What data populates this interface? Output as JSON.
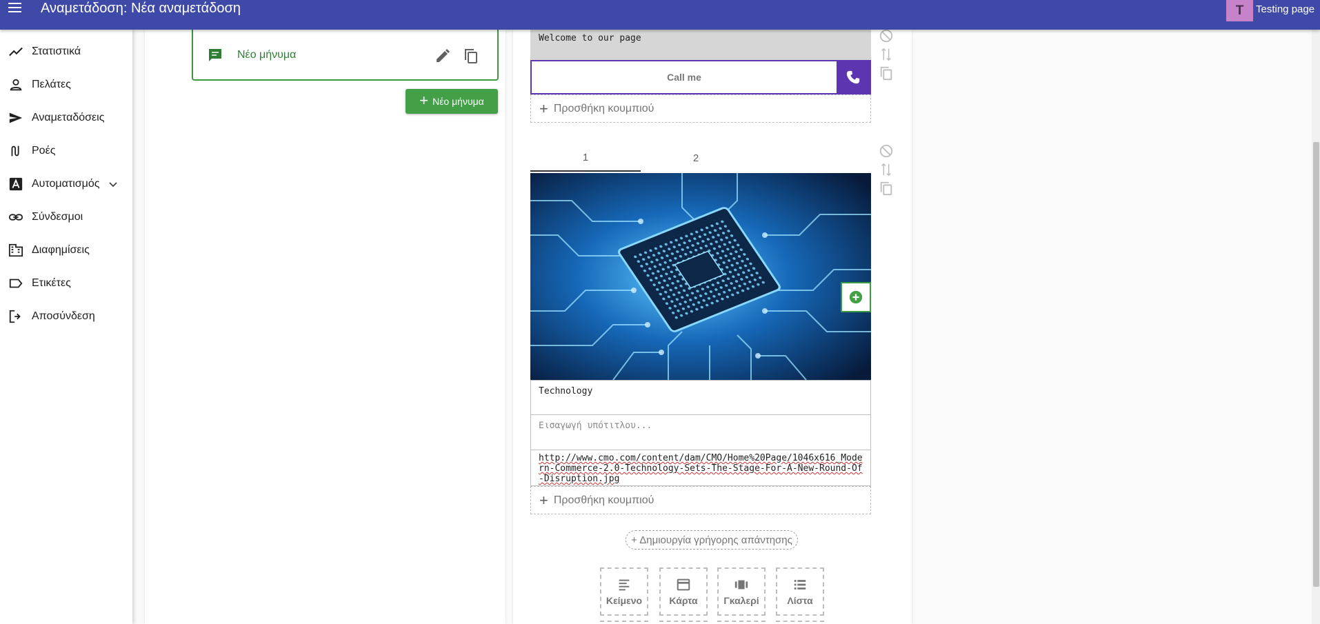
{
  "topbar": {
    "title": "Αναμετάδοση: Νέα αναμετάδοση",
    "page_avatar": "T",
    "page_name": "Testing page"
  },
  "sidebar": {
    "items": [
      {
        "label": "Στατιστικά",
        "icon": "trending-up-icon"
      },
      {
        "label": "Πελάτες",
        "icon": "person-icon"
      },
      {
        "label": "Αναμεταδόσεις",
        "icon": "send-icon"
      },
      {
        "label": "Ροές",
        "icon": "flow-icon"
      },
      {
        "label": "Αυτοματισμός",
        "icon": "automation-icon"
      },
      {
        "label": "Σύνδεσμοι",
        "icon": "link-icon"
      },
      {
        "label": "Διαφημίσεις",
        "icon": "business-icon"
      },
      {
        "label": "Ετικέτες",
        "icon": "label-icon"
      },
      {
        "label": "Αποσύνδεση",
        "icon": "logout-icon"
      }
    ]
  },
  "messages": {
    "card_label": "Νέο μήνυμα",
    "new_button_label": "Νέο μήνυμα"
  },
  "editor": {
    "welcome_text": "Welcome to our page",
    "call_button_label": "Call me",
    "add_button_label": "Προσθήκη κουμπιού",
    "tabs": [
      "1",
      "2"
    ],
    "card_title": "Technology",
    "subtitle_placeholder": "Εισαγωγή υπότιτλου...",
    "image_url": "http://www.cmo.com/content/dam/CMO/Home%20Page/1046x616_Modern-Commerce-2.0-Technology-Sets-The-Stage-For-A-New-Round-Of-Disruption.jpg",
    "quick_reply_label": "+ Δημιουργία γρήγορης απάντησης",
    "type_buttons": [
      {
        "label": "Κείμενο",
        "icon": "text-icon"
      },
      {
        "label": "Κάρτα",
        "icon": "card-icon"
      },
      {
        "label": "Γκαλερί",
        "icon": "gallery-icon"
      },
      {
        "label": "Λίστα",
        "icon": "list-icon"
      }
    ]
  },
  "colors": {
    "topbar": "#3f4aa8",
    "accent_green": "#43a047",
    "accent_purple": "#5e35b1"
  }
}
